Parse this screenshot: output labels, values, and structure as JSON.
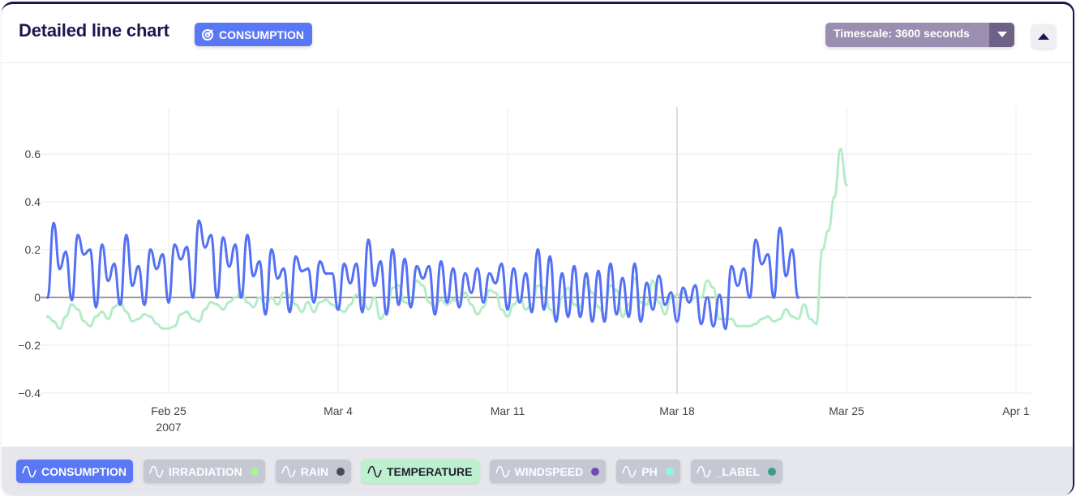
{
  "header": {
    "title": "Detailed line chart",
    "badge": "CONSUMPTION",
    "badge_icon": "target-icon",
    "timescale": "Timescale: 3600 seconds",
    "collapse_icon": "caret-up-icon"
  },
  "colors": {
    "consumption": "#5470f5",
    "temperature": "#b5ecc8",
    "grid": "#ebebeb",
    "zero": "#333333"
  },
  "legend": [
    {
      "label": "CONSUMPTION",
      "bg": "#5a78f5",
      "fg": "#ffffff",
      "dot": null
    },
    {
      "label": "IRRADIATION",
      "bg": "#c5c7d3",
      "fg": "#ffffff",
      "dot": "#a6f59a"
    },
    {
      "label": "RAIN",
      "bg": "#c5c7d3",
      "fg": "#ffffff",
      "dot": "#4a4a55"
    },
    {
      "label": "TEMPERATURE",
      "bg": "#bdf0cf",
      "fg": "#1f1f2e",
      "dot": null
    },
    {
      "label": "WINDSPEED",
      "bg": "#c5c7d3",
      "fg": "#ffffff",
      "dot": "#6b4fb0"
    },
    {
      "label": "PH",
      "bg": "#c5c7d3",
      "fg": "#ffffff",
      "dot": "#8ff5e0"
    },
    {
      "label": "_LABEL",
      "bg": "#c5c7d3",
      "fg": "#ffffff",
      "dot": "#3e9c82"
    }
  ],
  "chart_data": {
    "type": "line",
    "ylim": [
      -0.4,
      0.8
    ],
    "grid": true,
    "yticks": [
      {
        "v": -0.4,
        "label": "−0.4"
      },
      {
        "v": -0.2,
        "label": "−0.2"
      },
      {
        "v": 0,
        "label": "0"
      },
      {
        "v": 0.2,
        "label": "0.2"
      },
      {
        "v": 0.4,
        "label": "0.4"
      },
      {
        "v": 0.6,
        "label": "0.6"
      }
    ],
    "xticks": [
      {
        "date": "2007-02-25",
        "label": "Feb 25",
        "sub": "2007"
      },
      {
        "date": "2007-03-04",
        "label": "Mar 4"
      },
      {
        "date": "2007-03-11",
        "label": "Mar 11"
      },
      {
        "date": "2007-03-18",
        "label": "Mar 18"
      },
      {
        "date": "2007-03-25",
        "label": "Mar 25"
      },
      {
        "date": "2007-04-01",
        "label": "Apr 1"
      }
    ],
    "xlim": [
      "2007-02-19T18:00",
      "2007-04-01T15:00"
    ],
    "hours": [
      0,
      6,
      12,
      18
    ],
    "series": [
      {
        "name": "CONSUMPTION",
        "days": [
          [
            "2007-02-20",
            [
              0.0,
              0.31,
              0.12,
              0.19
            ]
          ],
          [
            "2007-02-21",
            [
              -0.01,
              0.26,
              0.18,
              0.2
            ]
          ],
          [
            "2007-02-22",
            [
              -0.04,
              0.22,
              0.07,
              0.14
            ]
          ],
          [
            "2007-02-23",
            [
              -0.03,
              0.26,
              0.05,
              0.13
            ]
          ],
          [
            "2007-02-24",
            [
              -0.03,
              0.2,
              0.12,
              0.18
            ]
          ],
          [
            "2007-02-25",
            [
              -0.02,
              0.22,
              0.16,
              0.21
            ]
          ],
          [
            "2007-02-26",
            [
              0.0,
              0.32,
              0.21,
              0.26
            ]
          ],
          [
            "2007-02-27",
            [
              0.0,
              0.25,
              0.13,
              0.22
            ]
          ],
          [
            "2007-02-28",
            [
              0.0,
              0.26,
              0.09,
              0.15
            ]
          ],
          [
            "2007-03-01",
            [
              -0.07,
              0.2,
              0.08,
              0.12
            ]
          ],
          [
            "2007-03-02",
            [
              -0.06,
              0.17,
              0.11,
              0.12
            ]
          ],
          [
            "2007-03-03",
            [
              -0.02,
              0.15,
              0.1,
              0.1
            ]
          ],
          [
            "2007-03-04",
            [
              -0.05,
              0.14,
              0.06,
              0.14
            ]
          ],
          [
            "2007-03-05",
            [
              -0.06,
              0.24,
              0.05,
              0.15
            ]
          ],
          [
            "2007-03-06",
            [
              -0.07,
              0.2,
              -0.03,
              0.16
            ]
          ],
          [
            "2007-03-07",
            [
              -0.04,
              0.13,
              0.08,
              0.13
            ]
          ],
          [
            "2007-03-08",
            [
              -0.07,
              0.15,
              -0.02,
              0.12
            ]
          ],
          [
            "2007-03-09",
            [
              -0.04,
              0.1,
              0.02,
              0.12
            ]
          ],
          [
            "2007-03-10",
            [
              -0.02,
              0.1,
              0.06,
              0.14
            ]
          ],
          [
            "2007-03-11",
            [
              -0.05,
              0.12,
              -0.02,
              0.1
            ]
          ],
          [
            "2007-03-12",
            [
              -0.06,
              0.2,
              -0.05,
              0.17
            ]
          ],
          [
            "2007-03-13",
            [
              -0.1,
              0.1,
              -0.08,
              0.13
            ]
          ],
          [
            "2007-03-14",
            [
              -0.08,
              0.1,
              -0.1,
              0.11
            ]
          ],
          [
            "2007-03-15",
            [
              -0.1,
              0.14,
              -0.07,
              0.08
            ]
          ],
          [
            "2007-03-16",
            [
              -0.08,
              0.14,
              -0.1,
              0.06
            ]
          ],
          [
            "2007-03-17",
            [
              -0.05,
              0.09,
              -0.03,
              0.02
            ]
          ],
          [
            "2007-03-18",
            [
              -0.1,
              0.04,
              -0.02,
              0.05
            ]
          ],
          [
            "2007-03-19",
            [
              -0.11,
              0.0,
              -0.12,
              0.01
            ]
          ],
          [
            "2007-03-20",
            [
              -0.13,
              0.13,
              0.05,
              0.12
            ]
          ],
          [
            "2007-03-21",
            [
              0.0,
              0.24,
              0.14,
              0.18
            ]
          ],
          [
            "2007-03-22",
            [
              0.0,
              0.29,
              0.09,
              0.2
            ]
          ],
          [
            "2007-03-23",
            [
              0.0
            ]
          ]
        ]
      },
      {
        "name": "TEMPERATURE",
        "days": [
          [
            "2007-02-20",
            [
              -0.08,
              -0.1,
              -0.13,
              -0.08
            ]
          ],
          [
            "2007-02-21",
            [
              -0.03,
              -0.05,
              -0.1,
              -0.12
            ]
          ],
          [
            "2007-02-22",
            [
              -0.08,
              -0.06,
              -0.09,
              -0.04
            ]
          ],
          [
            "2007-02-23",
            [
              -0.02,
              -0.06,
              -0.1,
              -0.09
            ]
          ],
          [
            "2007-02-24",
            [
              -0.07,
              -0.08,
              -0.11,
              -0.13
            ]
          ],
          [
            "2007-02-25",
            [
              -0.13,
              -0.12,
              -0.07,
              -0.06
            ]
          ],
          [
            "2007-02-26",
            [
              -0.09,
              -0.1,
              -0.05,
              -0.02
            ]
          ],
          [
            "2007-02-27",
            [
              -0.03,
              -0.05,
              -0.02,
              0.0
            ]
          ],
          [
            "2007-02-28",
            [
              0.02,
              -0.02,
              -0.04,
              0.0
            ]
          ],
          [
            "2007-03-01",
            [
              -0.03,
              0.0,
              -0.03,
              0.02
            ]
          ],
          [
            "2007-03-02",
            [
              0.01,
              -0.03,
              -0.06,
              -0.02
            ]
          ],
          [
            "2007-03-03",
            [
              -0.06,
              -0.02,
              -0.01,
              -0.03
            ]
          ],
          [
            "2007-03-04",
            [
              -0.05,
              -0.06,
              -0.03,
              0.01
            ]
          ],
          [
            "2007-03-05",
            [
              -0.01,
              -0.05,
              0.0,
              -0.09
            ]
          ],
          [
            "2007-03-06",
            [
              -0.06,
              0.04,
              0.05,
              -0.02
            ]
          ],
          [
            "2007-03-07",
            [
              -0.03,
              0.07,
              0.05,
              -0.02
            ]
          ],
          [
            "2007-03-08",
            [
              -0.04,
              -0.01,
              -0.03,
              -0.01
            ]
          ],
          [
            "2007-03-09",
            [
              -0.02,
              0.02,
              -0.03,
              -0.07
            ]
          ],
          [
            "2007-03-10",
            [
              -0.04,
              0.03,
              0.02,
              -0.05
            ]
          ],
          [
            "2007-03-11",
            [
              -0.08,
              -0.03,
              0.0,
              -0.05
            ]
          ],
          [
            "2007-03-12",
            [
              -0.03,
              0.05,
              0.04,
              -0.05
            ]
          ],
          [
            "2007-03-13",
            [
              -0.08,
              0.0,
              0.04,
              -0.03
            ]
          ],
          [
            "2007-03-14",
            [
              -0.04,
              0.06,
              0.02,
              -0.04
            ]
          ],
          [
            "2007-03-15",
            [
              -0.07,
              0.05,
              0.03,
              -0.08
            ]
          ],
          [
            "2007-03-16",
            [
              -0.03,
              0.08,
              -0.02,
              -0.03
            ]
          ],
          [
            "2007-03-17",
            [
              0.07,
              -0.02,
              -0.07,
              0.0
            ]
          ],
          [
            "2007-03-18",
            [
              0.01,
              0.02,
              -0.02,
              0.0
            ]
          ],
          [
            "2007-03-19",
            [
              0.0,
              0.07,
              0.04,
              -0.09
            ]
          ],
          [
            "2007-03-20",
            [
              -0.09,
              -0.09,
              -0.12,
              -0.12
            ]
          ],
          [
            "2007-03-21",
            [
              -0.12,
              -0.11,
              -0.09,
              -0.08
            ]
          ],
          [
            "2007-03-22",
            [
              -0.1,
              -0.09,
              -0.05,
              -0.08
            ]
          ],
          [
            "2007-03-23",
            [
              -0.09,
              -0.03,
              -0.09,
              -0.11
            ]
          ],
          [
            "2007-03-24",
            [
              0.2,
              0.28,
              0.42,
              0.62
            ]
          ],
          [
            "2007-03-25",
            [
              0.47
            ]
          ]
        ]
      }
    ]
  }
}
